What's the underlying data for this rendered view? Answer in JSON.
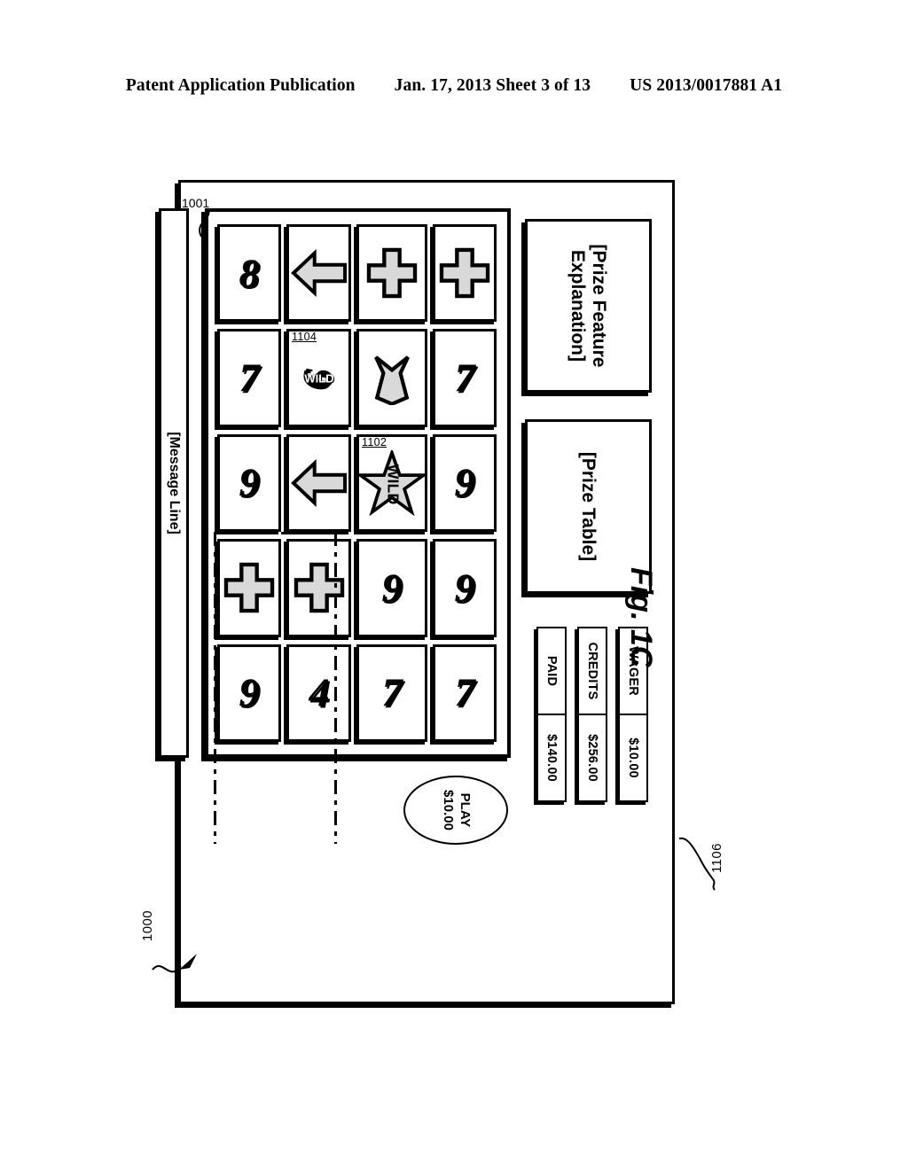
{
  "page_header": {
    "publication": "Patent Application Publication",
    "date_sheet": "Jan. 17, 2013  Sheet 3 of 13",
    "patent_number": "US 2013/0017881 A1"
  },
  "figure": {
    "label": "Fig. 1C",
    "reference_numerals": {
      "machine": "1000",
      "reel_window": "1001",
      "wild_star_cell": "1102",
      "wild_nine_cell": "1104",
      "payline": "1106"
    }
  },
  "display": {
    "prize_feature_explanation": "[Prize Feature Explanation]",
    "prize_table": "[Prize Table]",
    "message_line": "[Message Line]"
  },
  "meters": [
    {
      "label": "WAGER",
      "value": "$10.00"
    },
    {
      "label": "CREDITS",
      "value": "$256.00"
    },
    {
      "label": "PAID",
      "value": "$140.00"
    }
  ],
  "play_button": {
    "line1": "PLAY",
    "line2": "$10.00"
  },
  "reel_grid": {
    "columns": 5,
    "rows": 4,
    "cells": [
      {
        "symbol": "cross",
        "text": "",
        "ref": ""
      },
      {
        "symbol": "seven",
        "text": "7",
        "ref": ""
      },
      {
        "symbol": "nine",
        "text": "9",
        "ref": ""
      },
      {
        "symbol": "nine",
        "text": "9",
        "ref": ""
      },
      {
        "symbol": "seven",
        "text": "7",
        "ref": ""
      },
      {
        "symbol": "cross",
        "text": "",
        "ref": ""
      },
      {
        "symbol": "tie",
        "text": "",
        "ref": ""
      },
      {
        "symbol": "wild-star",
        "text": "WILD",
        "ref": "1102"
      },
      {
        "symbol": "nine",
        "text": "9",
        "ref": ""
      },
      {
        "symbol": "seven",
        "text": "7",
        "ref": ""
      },
      {
        "symbol": "arrow",
        "text": "",
        "ref": ""
      },
      {
        "symbol": "wild-nine",
        "text": "9",
        "ref": "1104"
      },
      {
        "symbol": "arrow",
        "text": "",
        "ref": ""
      },
      {
        "symbol": "cross",
        "text": "",
        "ref": ""
      },
      {
        "symbol": "four",
        "text": "4",
        "ref": ""
      },
      {
        "symbol": "eight",
        "text": "8",
        "ref": ""
      },
      {
        "symbol": "seven",
        "text": "7",
        "ref": ""
      },
      {
        "symbol": "nine",
        "text": "9",
        "ref": ""
      },
      {
        "symbol": "cross",
        "text": "",
        "ref": ""
      },
      {
        "symbol": "nine",
        "text": "9",
        "ref": ""
      }
    ]
  },
  "colors": {
    "line": "#000000",
    "symbol_fill": "#d9d9d9",
    "background": "#ffffff"
  }
}
